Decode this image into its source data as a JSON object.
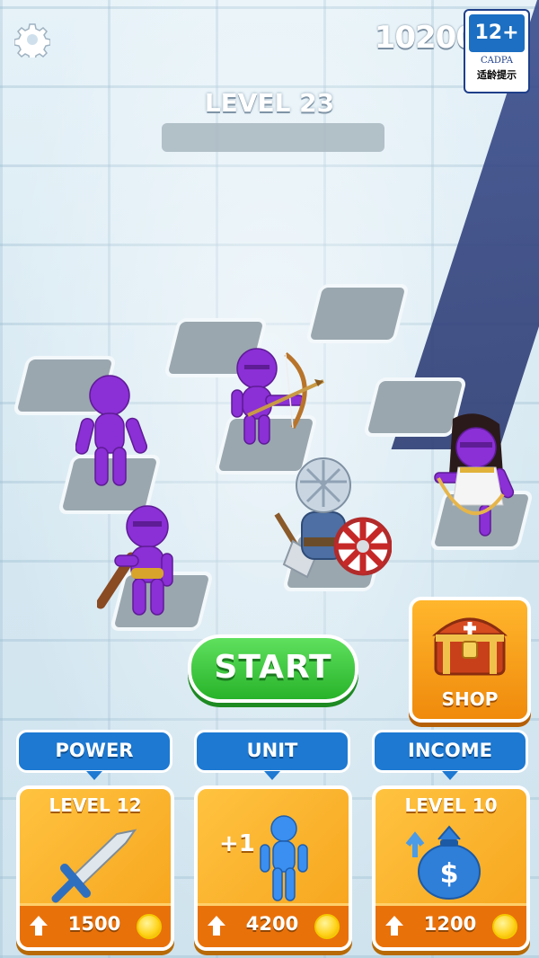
{
  "hud": {
    "currency": "10200",
    "age_rating": {
      "label": "12+",
      "org": "CADPA",
      "note": "适龄提示"
    }
  },
  "level": {
    "title": "LEVEL 23",
    "progress": 0
  },
  "buttons": {
    "start": "START",
    "shop": "SHOP"
  },
  "upgrades": [
    {
      "tab": "POWER",
      "level": "LEVEL 12",
      "price": "1500",
      "icon": "sword-icon"
    },
    {
      "tab": "UNIT",
      "level": "",
      "bonus": "+1",
      "price": "4200",
      "icon": "unit-figure-icon"
    },
    {
      "tab": "INCOME",
      "level": "LEVEL 10",
      "price": "1200",
      "icon": "money-bag-icon"
    }
  ],
  "colors": {
    "enemy": "#8b2fd6",
    "start": "#34c13a",
    "upgrade_tab": "#1d79d2",
    "card": "#f6a21a"
  }
}
